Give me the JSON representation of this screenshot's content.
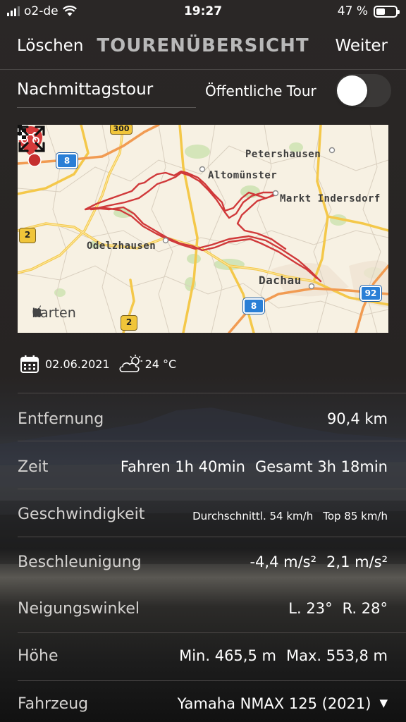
{
  "status_bar": {
    "carrier": "o2-de",
    "time": "19:27",
    "battery": "47 %",
    "battery_level": 0.47
  },
  "nav": {
    "left_label": "Löschen",
    "title": "TOURENÜBERSICHT",
    "right_label": "Weiter"
  },
  "tour": {
    "name": "Nachmittagstour",
    "public_label": "Öffentliche Tour",
    "public_enabled": false
  },
  "map": {
    "places": [
      "Petershausen",
      "Altomünster",
      "Markt Indersdorf",
      "Odelzhausen",
      "Dachau"
    ],
    "roads": [
      "300",
      "8",
      "2",
      "8",
      "2",
      "92"
    ],
    "attribution": "Karten",
    "route_color": "#d0393a"
  },
  "meta": {
    "date": "02.06.2021",
    "temperature": "24 °C",
    "weather_icon": "partly-cloudy-icon"
  },
  "stats": {
    "distance": {
      "label": "Entfernung",
      "value": "90,4 km"
    },
    "time": {
      "label": "Zeit",
      "drive": "Fahren 1h 40min",
      "total": "Gesamt 3h 18min"
    },
    "speed": {
      "label": "Geschwindigkeit",
      "avg": "Durchschnittl. 54 km/h",
      "top": "Top 85 km/h"
    },
    "acceleration": {
      "label": "Beschleunigung",
      "min": "-4,4 m/s²",
      "max": "2,1 m/s²"
    },
    "lean": {
      "label": "Neigungswinkel",
      "left": "L. 23°",
      "right": "R. 28°"
    },
    "altitude": {
      "label": "Höhe",
      "min": "Min. 465,5 m",
      "max": "Max. 553,8 m"
    },
    "vehicle": {
      "label": "Fahrzeug",
      "value": "Yamaha NMAX 125 (2021)"
    }
  }
}
